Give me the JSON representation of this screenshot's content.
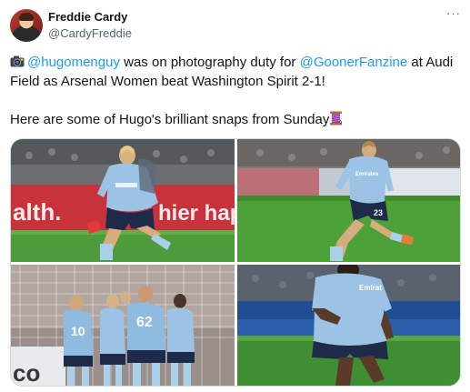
{
  "tweet": {
    "author_name": "Freddie Cardy",
    "author_handle": "@CardyFreddie",
    "more_icon": "···",
    "line1_prefix": " ",
    "mention1": "@hugomenguy",
    "line1_mid": " was on photography duty for ",
    "mention2": "@GoonerFanzine",
    "line1_end": " at Audi",
    "line2": "Field as Arsenal Women beat Washington Spirit 2-1!",
    "line3": "Here are some of Hugo's brilliant snaps from Sunday",
    "emoji_start": "camera-with-flash-icon",
    "emoji_end": "thread-spool-icon"
  },
  "photos": {
    "p1": {
      "board_text": "alth.   hier happ"
    },
    "p2": {
      "board_text": "Emirates",
      "shirt_number": "23"
    },
    "p3": {
      "shirt_numbers": [
        "10",
        "62"
      ]
    },
    "p4": {
      "board_text": "Emirat"
    }
  },
  "colors": {
    "mention": "#1d9bf0",
    "text": "#0f1419",
    "muted": "#536471",
    "kit_blue": "#9cc3e6",
    "shorts_navy": "#1e2a4a",
    "pitch_green": "#4a9a3a",
    "board_red": "#c8323a"
  }
}
